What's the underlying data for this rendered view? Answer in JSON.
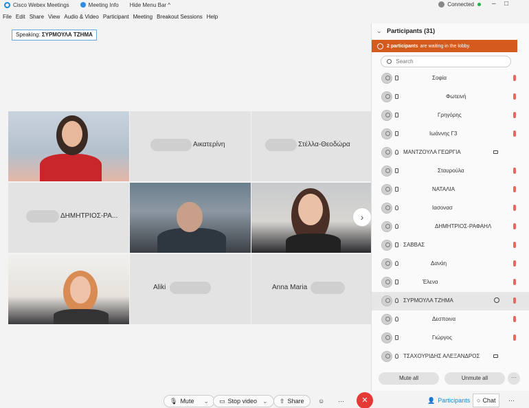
{
  "titlebar": {
    "app_name": "Cisco Webex Meetings",
    "meeting_info": "Meeting Info",
    "hide_menu": "Hide Menu Bar ^",
    "connection": "Connected",
    "min": "–",
    "max": "□"
  },
  "menu": [
    "File",
    "Edit",
    "Share",
    "View",
    "Audio & Video",
    "Participant",
    "Meeting",
    "Breakout Sessions",
    "Help"
  ],
  "speaking": {
    "label": "Speaking:",
    "name": "ΣΥΡΜΟΥΛΑ ΤΖΗΜΑ"
  },
  "tiles": {
    "t2": "Αικατερίνη",
    "t3": "Στέλλα-Θεοδώρα",
    "t4": "ΔΗΜΗΤΡΙΟΣ-ΡΑ...",
    "t8": "Aliki",
    "t9": "Anna Maria"
  },
  "next_arrow": "›",
  "panel": {
    "title": "Participants (31)",
    "lobby_count": "2 participants",
    "lobby_text": "are waiting in the lobby.",
    "search_placeholder": "Search",
    "participants": [
      {
        "name": "Σοφία"
      },
      {
        "name": "Φωτεινή"
      },
      {
        "name": "Γρηγόρης"
      },
      {
        "name": "Ιωάννης Γ3"
      },
      {
        "name": "ΜΑΝΤΖΟΥΛΑ ΓΕΩΡΓΙΑ"
      },
      {
        "name": "Σταυρούλα"
      },
      {
        "name": "ΝΑΤΑΛΙΑ"
      },
      {
        "name": "Ιασονασ"
      },
      {
        "name": "ΔΗΜΗΤΡΙΟΣ-ΡΑΦΑΗΛ"
      },
      {
        "name": "ΣΑΒΒΑΣ"
      },
      {
        "name": "Δανάη"
      },
      {
        "name": "Έλενα"
      },
      {
        "name": "ΣΥΡΜΟΥΛΑ ΤΖΗΜΑ"
      },
      {
        "name": "Δεσποινα"
      },
      {
        "name": "Γιώργος"
      },
      {
        "name": "ΤΣΑΧΟΥΡΙΔΗΣ ΑΛΕΞΑΝΔΡΟΣ"
      }
    ],
    "mute_all": "Mute all",
    "unmute_all": "Unmute all",
    "more": "···"
  },
  "controls": {
    "mute": "Mute",
    "stop_video": "Stop video",
    "share": "Share",
    "more": "···",
    "end": "✕",
    "participants_tab": "Participants",
    "chat_tab": "Chat",
    "more_tab": "···"
  },
  "colors": {
    "accent": "#1a8ad8",
    "lobby": "#d55a1e",
    "end": "#e53935",
    "connected": "#22b14c"
  }
}
